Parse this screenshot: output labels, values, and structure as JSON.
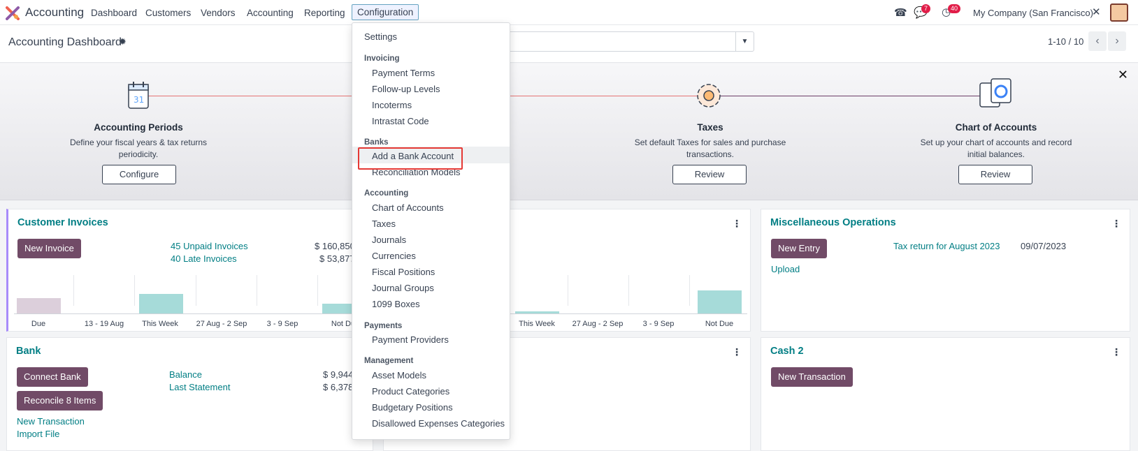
{
  "navbar": {
    "app_name": "Accounting",
    "menu": [
      "Dashboard",
      "Customers",
      "Vendors",
      "Accounting",
      "Reporting",
      "Configuration"
    ],
    "active_menu": "Configuration",
    "messages_badge": "7",
    "activities_badge": "40",
    "company": "My Company (San Francisco)"
  },
  "control": {
    "title": "Accounting Dashboard",
    "pager": "1-10 / 10"
  },
  "banner": {
    "steps": [
      {
        "title": "Accounting Periods",
        "desc_line1": "Define your fiscal years & tax returns",
        "desc_line2": "periodicity.",
        "button": "Configure"
      },
      {
        "title": "Taxes",
        "desc_line1": "Set default Taxes for sales and purchase",
        "desc_line2": "transactions.",
        "button": "Review"
      },
      {
        "title": "Chart of Accounts",
        "desc_line1": "Set up your chart of accounts and record",
        "desc_line2": "initial balances.",
        "button": "Review"
      }
    ],
    "colors": {
      "line_left": "#e57373",
      "line_right": "#6d3d67"
    }
  },
  "customer_invoices": {
    "title": "Customer Invoices",
    "button": "New Invoice",
    "unpaid_label": "45 Unpaid Invoices",
    "unpaid_amount": "$ 160,850",
    "late_label": "40 Late Invoices",
    "late_amount": "$ 53,877",
    "x_labels": [
      "Due",
      "13 - 19 Aug",
      "This Week",
      "27 Aug - 2 Sep",
      "3 - 9 Sep",
      "Not Du"
    ]
  },
  "vendor_bills_partial": {
    "x_labels": [
      "This Week",
      "27 Aug - 2 Sep",
      "3 - 9 Sep",
      "Not Due"
    ]
  },
  "misc_operations": {
    "title": "Miscellaneous Operations",
    "button": "New Entry",
    "upload": "Upload",
    "tax_return": "Tax return for August 2023",
    "date": "09/07/2023"
  },
  "bank": {
    "title": "Bank",
    "connect": "Connect Bank",
    "reconcile": "Reconcile 8 Items",
    "new_transaction": "New Transaction",
    "import_file": "Import File",
    "balance_label": "Balance",
    "balance_amount": "$ 9,944",
    "last_statement_label": "Last Statement",
    "last_statement_amount": "$ 6,378"
  },
  "cash2": {
    "title": "Cash 2",
    "button": "New Transaction"
  },
  "dropdown": {
    "settings": "Settings",
    "sections": [
      {
        "heading": "Invoicing",
        "items": [
          "Payment Terms",
          "Follow-up Levels",
          "Incoterms",
          "Intrastat Code"
        ]
      },
      {
        "heading": "Banks",
        "items": [
          "Add a Bank Account",
          "Reconciliation Models"
        ]
      },
      {
        "heading": "Accounting",
        "items": [
          "Chart of Accounts",
          "Taxes",
          "Journals",
          "Currencies",
          "Fiscal Positions",
          "Journal Groups",
          "1099 Boxes"
        ]
      },
      {
        "heading": "Payments",
        "items": [
          "Payment Providers"
        ]
      },
      {
        "heading": "Management",
        "items": [
          "Asset Models",
          "Product Categories",
          "Budgetary Positions",
          "Disallowed Expenses Categories"
        ]
      }
    ]
  },
  "theme": {
    "primary": "#714b67",
    "link": "#017e84",
    "highlight": "#e53935"
  }
}
